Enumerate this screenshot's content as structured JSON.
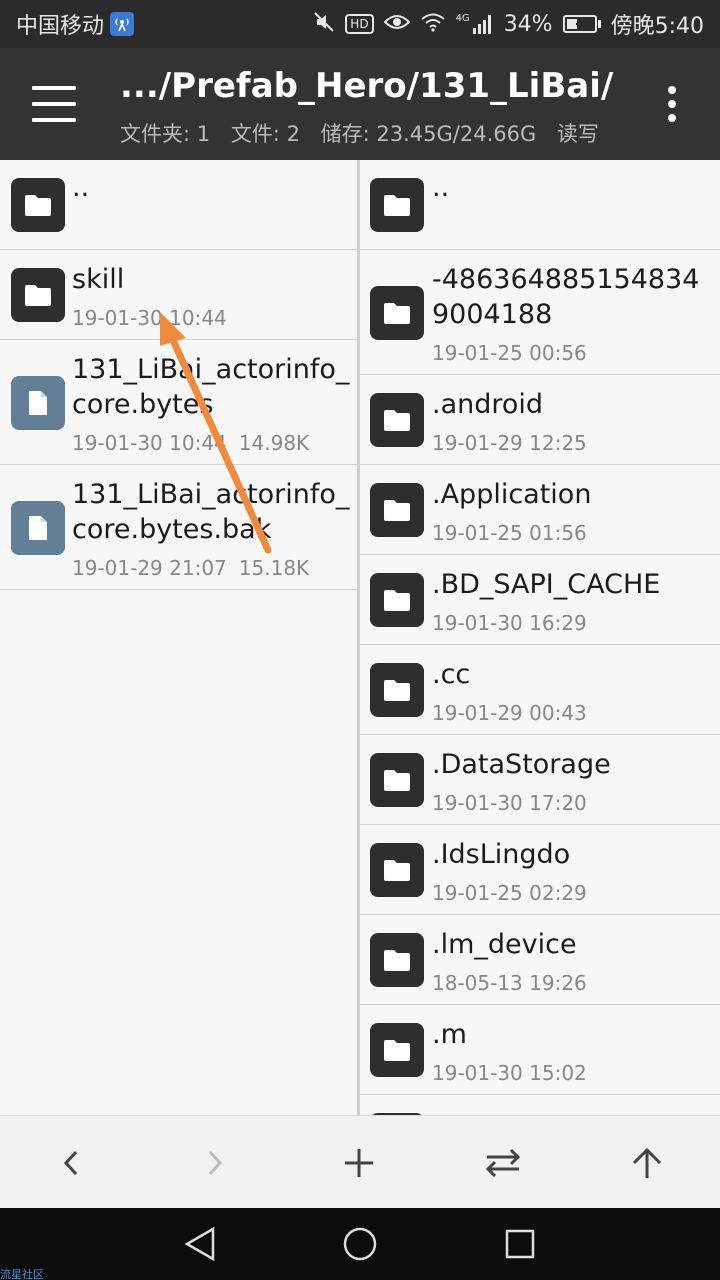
{
  "status_bar": {
    "carrier": "中国移动",
    "carrier_badge_icon": "signal-tower-icon",
    "hd_label": "HD",
    "network_label": "4G",
    "battery_percent": "34%",
    "battery_level": 0.34,
    "time": "傍晚5:40"
  },
  "app_bar": {
    "path": ".../Prefab_Hero/131_LiBai/",
    "folders": "文件夹: 1",
    "files": "文件: 2",
    "storage": "储存: 23.45G/24.66G",
    "mode": "读写"
  },
  "left_pane": {
    "items": [
      {
        "type": "folder",
        "name": "..",
        "date": "",
        "size": ""
      },
      {
        "type": "folder",
        "name": "skill",
        "date": "19-01-30 10:44",
        "size": ""
      },
      {
        "type": "file",
        "name": "131_LiBai_actorinfo_core.bytes",
        "date": "19-01-30 10:44",
        "size": "14.98K"
      },
      {
        "type": "file",
        "name": "131_LiBai_actorinfo_core.bytes.bak",
        "date": "19-01-29 21:07",
        "size": "15.18K"
      }
    ]
  },
  "right_pane": {
    "items": [
      {
        "type": "folder",
        "name": "..",
        "date": ""
      },
      {
        "type": "folder",
        "name": "-4863648851548349004188",
        "date": "19-01-25 00:56"
      },
      {
        "type": "folder",
        "name": ".android",
        "date": "19-01-29 12:25"
      },
      {
        "type": "folder",
        "name": ".Application",
        "date": "19-01-25 01:56"
      },
      {
        "type": "folder",
        "name": ".BD_SAPI_CACHE",
        "date": "19-01-30 16:29"
      },
      {
        "type": "folder",
        "name": ".cc",
        "date": "19-01-29 00:43"
      },
      {
        "type": "folder",
        "name": ".DataStorage",
        "date": "19-01-30 17:20"
      },
      {
        "type": "folder",
        "name": ".IdsLingdo",
        "date": "19-01-25 02:29"
      },
      {
        "type": "folder",
        "name": ".lm_device",
        "date": "18-05-13 19:26"
      },
      {
        "type": "folder",
        "name": ".m",
        "date": "19-01-30 15:02"
      }
    ]
  },
  "bottom_bar": {
    "buttons": [
      "back-icon",
      "forward-icon",
      "add-icon",
      "swap-icon",
      "up-icon"
    ]
  },
  "nav_bar": {
    "buttons": [
      "nav-back-icon",
      "nav-home-icon",
      "nav-recents-icon"
    ]
  },
  "watermark": "流星社区",
  "annotation_arrow_color": "#f08a3c"
}
